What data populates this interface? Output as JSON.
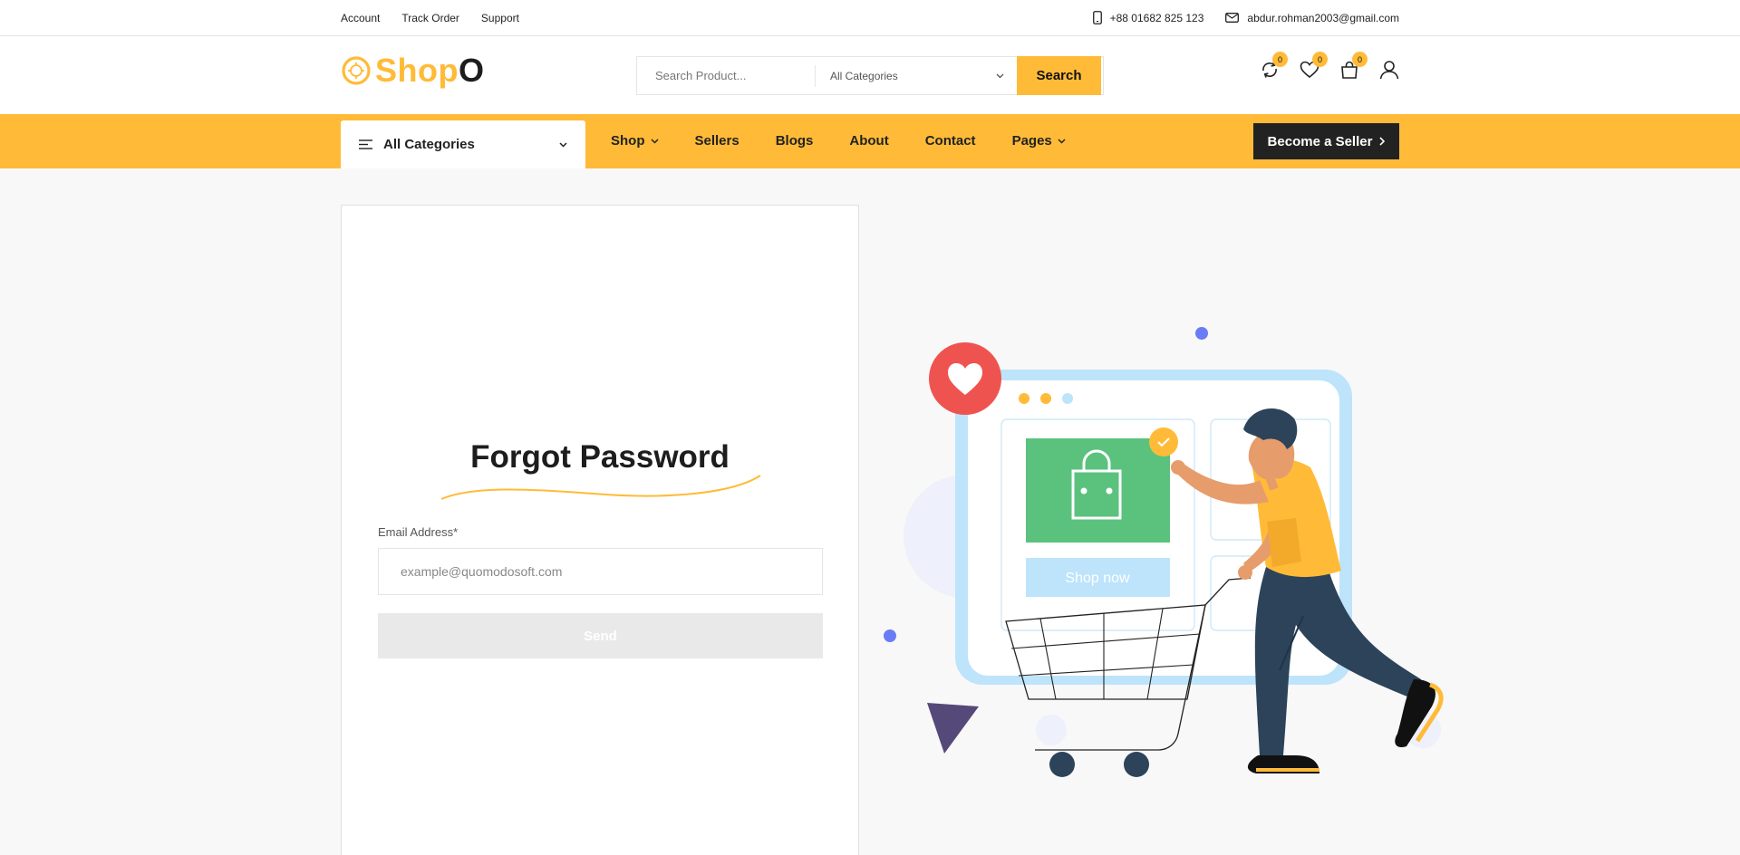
{
  "topbar": {
    "links": [
      "Account",
      "Track Order",
      "Support"
    ],
    "phone": "+88 01682 825 123",
    "email": "abdur.rohman2003@gmail.com"
  },
  "header": {
    "logo_text_main": "Shop",
    "logo_text_tail": "O",
    "search_placeholder": "Search Product...",
    "category_select": "All Categories",
    "search_button": "Search",
    "compare_count": "0",
    "wishlist_count": "0",
    "cart_count": "0"
  },
  "navbar": {
    "all_categories": "All Categories",
    "menu": [
      "Shop",
      "Sellers",
      "Blogs",
      "About",
      "Contact",
      "Pages"
    ],
    "become_seller": "Become a Seller"
  },
  "form": {
    "title": "Forgot Password",
    "email_label": "Email Address*",
    "email_placeholder": "example@quomodosoft.com",
    "send_button": "Send"
  },
  "illustration": {
    "shop_now": "Shop now"
  },
  "colors": {
    "accent": "#ffbb38",
    "dark": "#222222",
    "green": "#5bc27e",
    "red_circle": "#ef5350",
    "light_blue": "#bde4fb"
  }
}
